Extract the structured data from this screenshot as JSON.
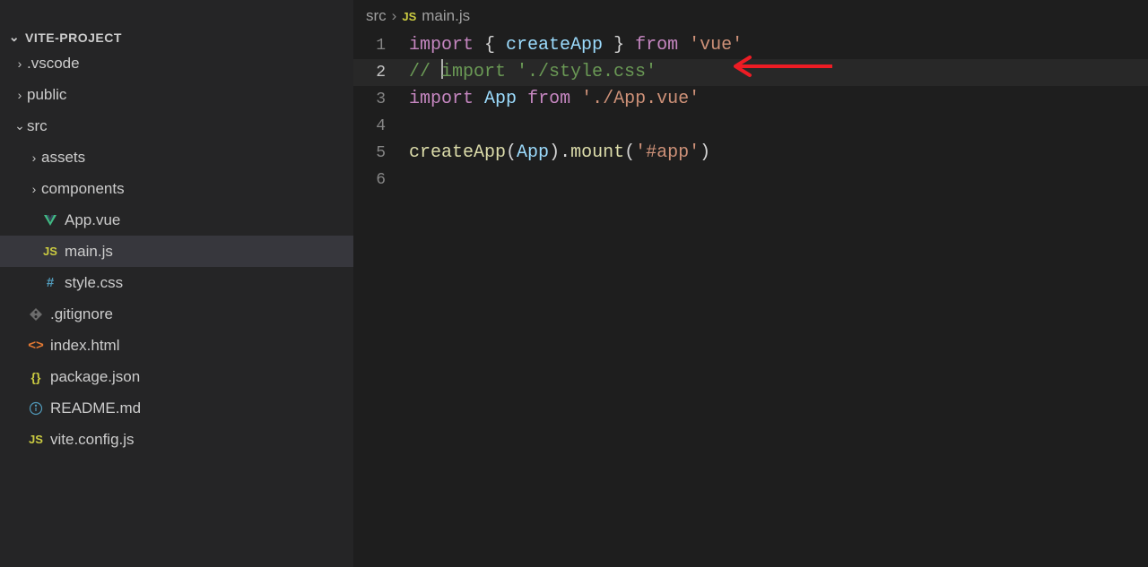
{
  "project": {
    "name": "VITE-PROJECT"
  },
  "tree": {
    "vscode": ".vscode",
    "public": "public",
    "src": "src",
    "assets": "assets",
    "components": "components",
    "app_vue": "App.vue",
    "main_js": "main.js",
    "style_css": "style.css",
    "gitignore": ".gitignore",
    "index_html": "index.html",
    "package_json": "package.json",
    "readme_md": "README.md",
    "vite_config": "vite.config.js"
  },
  "breadcrumb": {
    "folder": "src",
    "file": "main.js"
  },
  "code": {
    "l1": {
      "n": "1",
      "imp": "import",
      "p1": " { ",
      "fn": "createApp",
      "p2": " } ",
      "from": "from",
      "sp": " ",
      "str": "'vue'"
    },
    "l2": {
      "n": "2",
      "com": "// ",
      "com2": "import './style.css'"
    },
    "l3": {
      "n": "3",
      "imp": "import",
      "sp": " ",
      "var": "App",
      "sp2": " ",
      "from": "from",
      "sp3": " ",
      "str": "'./App.vue'"
    },
    "l4": {
      "n": "4"
    },
    "l5": {
      "n": "5",
      "fn": "createApp",
      "p1": "(",
      "var": "App",
      "p2": ").",
      "fn2": "mount",
      "p3": "(",
      "str": "'#app'",
      "p4": ")"
    },
    "l6": {
      "n": "6"
    }
  },
  "annotation": {
    "color": "#ed1c24"
  }
}
